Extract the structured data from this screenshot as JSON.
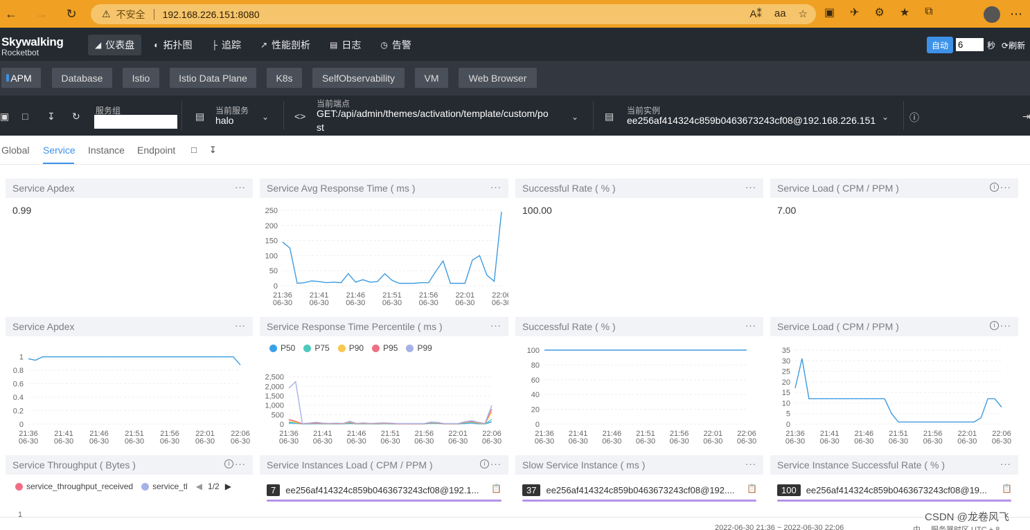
{
  "browser": {
    "warning_text": "不安全",
    "url": "192.168.226.151:8080"
  },
  "app": {
    "logo_main": "Skywalking",
    "logo_sub": "Rocketbot"
  },
  "topnav": {
    "items": [
      {
        "label": "仪表盘",
        "icon": "dashboard-icon",
        "active": true
      },
      {
        "label": "拓扑图",
        "icon": "topology-icon",
        "active": false
      },
      {
        "label": "追踪",
        "icon": "trace-icon",
        "active": false
      },
      {
        "label": "性能剖析",
        "icon": "profile-icon",
        "active": false
      },
      {
        "label": "日志",
        "icon": "log-icon",
        "active": false
      },
      {
        "label": "告警",
        "icon": "alarm-icon",
        "active": false
      }
    ],
    "auto_label": "自动",
    "interval_value": "6",
    "seconds_label": "秒",
    "refresh_label": "刷新"
  },
  "layers": [
    {
      "label": "APM",
      "active": true
    },
    {
      "label": "Database",
      "active": false
    },
    {
      "label": "Istio",
      "active": false
    },
    {
      "label": "Istio Data Plane",
      "active": false
    },
    {
      "label": "K8s",
      "active": false
    },
    {
      "label": "SelfObservability",
      "active": false
    },
    {
      "label": "VM",
      "active": false
    },
    {
      "label": "Web Browser",
      "active": false
    }
  ],
  "selectors": {
    "group_label": "服务组",
    "group_value": "",
    "service_label": "当前服务",
    "service_value": "halo",
    "endpoint_label": "当前端点",
    "endpoint_line1": "GET:/api/admin/themes/activation/template/custom/po",
    "endpoint_line2": "st",
    "instance_label": "当前实例",
    "instance_value": "ee256af414324c859b0463673243cf08@192.168.226.151"
  },
  "dashtabs": [
    "Global",
    "Service",
    "Instance",
    "Endpoint"
  ],
  "active_dashtab": "Service",
  "cards": {
    "apdex_title": "Service Apdex",
    "apdex_value": "0.99",
    "avg_rt_title": "Service Avg Response Time ( ms )",
    "sr_title": "Successful Rate ( % )",
    "sr_value": "100.00",
    "load_title": "Service Load ( CPM / PPM )",
    "load_value": "7.00",
    "apdex2_title": "Service Apdex",
    "percentile_title": "Service Response Time Percentile ( ms )",
    "sr2_title": "Successful Rate ( % )",
    "load2_title": "Service Load ( CPM / PPM )",
    "throughput_title": "Service Throughput ( Bytes )",
    "inst_load_title": "Service Instances Load ( CPM / PPM )",
    "slow_inst_title": "Slow Service Instance ( ms )",
    "inst_sr_title": "Service Instance Successful Rate ( % )"
  },
  "throughput_legend": {
    "item1": "service_throughput_received",
    "item2": "service_tl",
    "page": "1/2",
    "color1": "#ee6f84",
    "color2": "#a6b2e6"
  },
  "instance_lists": {
    "load": {
      "badge": "7",
      "name": "ee256af414324c859b0463673243cf08@192.1..."
    },
    "slow": {
      "badge": "37",
      "name": "ee256af414324c859b0463673243cf08@192...."
    },
    "sr": {
      "badge": "100",
      "name": "ee256af414324c859b0463673243cf08@19..."
    }
  },
  "footer": {
    "time_range": "2022-06-30 21:36 ~ 2022-06-30 22:06",
    "lang": "中",
    "tz": "服务器时区 UTC + 8"
  },
  "watermark": "CSDN @龙卷风飞",
  "colors": {
    "accent": "#3d92e8",
    "line": "#3d9be0",
    "instance_bar": "#b592e8"
  },
  "chart_data": [
    {
      "id": "avg_rt",
      "type": "line",
      "title": "Service Avg Response Time ( ms )",
      "x_ticks": [
        "21:36\n06-30",
        "21:41\n06-30",
        "21:46\n06-30",
        "21:51\n06-30",
        "21:56\n06-30",
        "22:01\n06-30",
        "22:06\n06-30"
      ],
      "y_ticks": [
        0,
        50,
        100,
        150,
        200,
        250
      ],
      "ylim": [
        0,
        250
      ],
      "series": [
        {
          "values": [
            145,
            125,
            8,
            10,
            16,
            14,
            10,
            12,
            10,
            40,
            12,
            20,
            12,
            14,
            40,
            18,
            8,
            8,
            8,
            10,
            10,
            48,
            82,
            8,
            8,
            8,
            85,
            100,
            35,
            15,
            245
          ]
        }
      ]
    },
    {
      "id": "apdex2",
      "type": "line",
      "title": "Service Apdex",
      "x_ticks": [
        "21:36\n06-30",
        "21:41\n06-30",
        "21:46\n06-30",
        "21:51\n06-30",
        "21:56\n06-30",
        "22:01\n06-30",
        "22:06\n06-30"
      ],
      "y_ticks": [
        "0",
        "0.2",
        "0.4",
        "0.6",
        "0.8",
        "1"
      ],
      "ylim": [
        0,
        1.1
      ],
      "series": [
        {
          "values": [
            0.97,
            0.95,
            1,
            1,
            1,
            1,
            1,
            1,
            1,
            1,
            1,
            1,
            1,
            1,
            1,
            1,
            1,
            1,
            1,
            1,
            1,
            1,
            1,
            1,
            1,
            1,
            1,
            1,
            1,
            1,
            0.88
          ]
        }
      ]
    },
    {
      "id": "percentile",
      "type": "line",
      "title": "Service Response Time Percentile ( ms )",
      "x_ticks": [
        "21:36\n06-30",
        "21:41\n06-30",
        "21:46\n06-30",
        "21:51\n06-30",
        "21:56\n06-30",
        "22:01\n06-30",
        "22:06\n06-30"
      ],
      "y_ticks": [
        "0",
        "500",
        "1,000",
        "1,500",
        "2,000",
        "2,500"
      ],
      "ylim": [
        0,
        2600
      ],
      "series": [
        {
          "name": "P50",
          "color": "#3aa1e8",
          "values": [
            50,
            40,
            10,
            10,
            20,
            15,
            10,
            12,
            10,
            30,
            10,
            15,
            10,
            12,
            20,
            15,
            10,
            10,
            10,
            10,
            10,
            40,
            30,
            10,
            10,
            10,
            30,
            60,
            20,
            10,
            120
          ]
        },
        {
          "name": "P75",
          "color": "#4ec9be",
          "values": [
            100,
            60,
            15,
            20,
            30,
            20,
            15,
            20,
            15,
            60,
            15,
            25,
            15,
            20,
            30,
            20,
            15,
            15,
            15,
            15,
            15,
            60,
            40,
            15,
            15,
            15,
            60,
            100,
            40,
            15,
            250
          ]
        },
        {
          "name": "P90",
          "color": "#f7c94c",
          "values": [
            180,
            100,
            20,
            30,
            50,
            30,
            20,
            30,
            20,
            90,
            20,
            40,
            20,
            30,
            40,
            30,
            20,
            20,
            20,
            20,
            20,
            80,
            60,
            20,
            20,
            20,
            90,
            130,
            60,
            20,
            650
          ]
        },
        {
          "name": "P95",
          "color": "#ee6f84",
          "values": [
            250,
            150,
            20,
            40,
            60,
            40,
            30,
            40,
            30,
            120,
            30,
            50,
            30,
            40,
            50,
            40,
            20,
            20,
            20,
            20,
            20,
            90,
            70,
            20,
            20,
            20,
            110,
            150,
            80,
            30,
            800
          ]
        },
        {
          "name": "P99",
          "color": "#a6b2e6",
          "values": [
            1900,
            2250,
            30,
            60,
            100,
            60,
            40,
            60,
            40,
            150,
            40,
            70,
            40,
            60,
            70,
            60,
            30,
            30,
            30,
            30,
            30,
            110,
            90,
            30,
            30,
            30,
            130,
            180,
            100,
            40,
            1000
          ]
        }
      ]
    },
    {
      "id": "sr2",
      "type": "line",
      "title": "Successful Rate ( % )",
      "x_ticks": [
        "21:36\n06-30",
        "21:41\n06-30",
        "21:46\n06-30",
        "21:51\n06-30",
        "21:56\n06-30",
        "22:01\n06-30",
        "22:06\n06-30"
      ],
      "y_ticks": [
        0,
        20,
        40,
        60,
        80,
        100
      ],
      "ylim": [
        0,
        100
      ],
      "series": [
        {
          "values": [
            100,
            100,
            100,
            100,
            100,
            100,
            100,
            100,
            100,
            100,
            100,
            100,
            100,
            100,
            100,
            100,
            100,
            100,
            100,
            100,
            100,
            100,
            100,
            100,
            100,
            100,
            100,
            100,
            100,
            100,
            100
          ]
        }
      ]
    },
    {
      "id": "load2",
      "type": "line",
      "title": "Service Load ( CPM / PPM )",
      "x_ticks": [
        "21:36\n06-30",
        "21:41\n06-30",
        "21:46\n06-30",
        "21:51\n06-30",
        "21:56\n06-30",
        "22:01\n06-30",
        "22:06\n06-30"
      ],
      "y_ticks": [
        0,
        5,
        10,
        15,
        20,
        25,
        30,
        35
      ],
      "ylim": [
        0,
        35
      ],
      "series": [
        {
          "values": [
            17,
            31,
            12,
            12,
            12,
            12,
            12,
            12,
            12,
            12,
            12,
            12,
            12,
            12,
            5,
            1,
            1,
            1,
            1,
            1,
            1,
            1,
            1,
            1,
            1,
            1,
            1,
            3,
            12,
            12,
            8
          ]
        }
      ]
    }
  ]
}
